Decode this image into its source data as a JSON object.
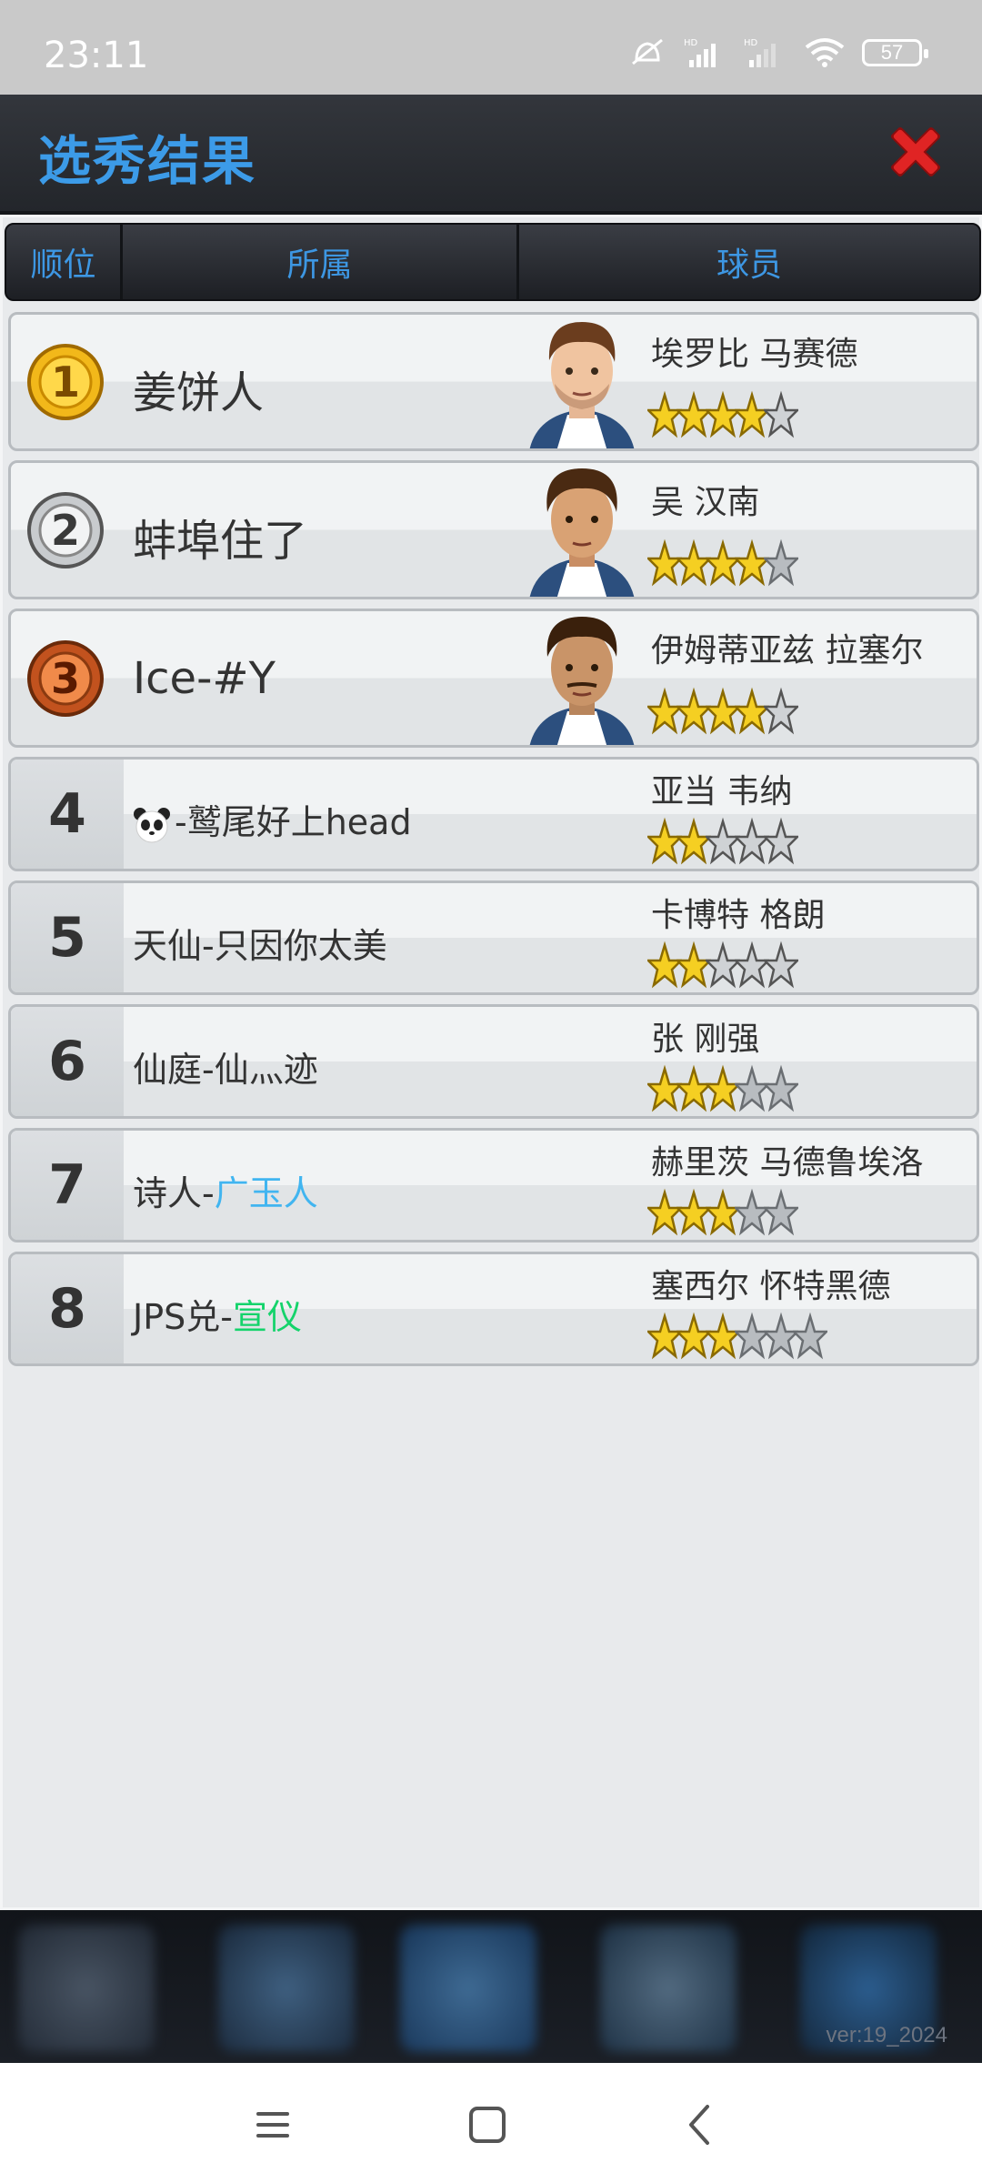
{
  "status_bar": {
    "time": "23:11",
    "battery": "57"
  },
  "title": "选秀结果",
  "header": {
    "rank": "顺位",
    "team": "所属",
    "player": "球员"
  },
  "rows": [
    {
      "rank": "1",
      "medal": "gold",
      "team": "姜饼人",
      "player": "埃罗比 马赛德",
      "stars": [
        1,
        1,
        1,
        1,
        0.5
      ]
    },
    {
      "rank": "2",
      "medal": "silver",
      "team": "蚌埠住了",
      "player": "吴 汉南",
      "stars": [
        1,
        1,
        1,
        1,
        0
      ]
    },
    {
      "rank": "3",
      "medal": "bronze",
      "team": "Ice-#Y",
      "player": "伊姆蒂亚兹 拉塞尔",
      "stars": [
        1,
        1,
        1,
        1,
        0.5
      ]
    },
    {
      "rank": "4",
      "team": "-鹫尾好上head",
      "player": "亚当 韦纳",
      "stars": [
        1,
        1,
        0.5,
        0.5,
        0.5
      ]
    },
    {
      "rank": "5",
      "team": "天仙-只因你太美",
      "player": "卡博特 格朗",
      "stars": [
        1,
        1,
        0.5,
        0.5,
        0.5
      ]
    },
    {
      "rank": "6",
      "team": "仙庭-仙灬迹",
      "player": "张 刚强",
      "stars": [
        1,
        1,
        1,
        0,
        0
      ]
    },
    {
      "rank": "7",
      "team_prefix": "诗人-",
      "team_highlight": "广玉人",
      "player": "赫里茨 马德鲁埃洛",
      "stars": [
        1,
        1,
        1,
        0,
        0
      ]
    },
    {
      "rank": "8",
      "team_prefix": "JPS兑-",
      "team_highlight": "宣仪",
      "player": "塞西尔 怀特黑德",
      "stars": [
        1,
        1,
        1,
        0,
        0,
        0
      ]
    }
  ],
  "dock": {
    "version": "ver:19_2024"
  },
  "colors": {
    "title_blue": "#3c9be8",
    "close_red": "#d81e1e",
    "highlight_blue": "#41b5f0",
    "highlight_green": "#14d36b"
  }
}
